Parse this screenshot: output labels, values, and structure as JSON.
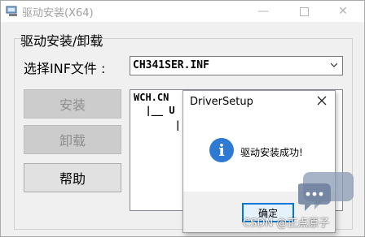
{
  "window": {
    "title": "驱动安装(X64)",
    "controls": {
      "minimize": "—",
      "close": "✕"
    }
  },
  "group": {
    "title": "驱动安装/卸载"
  },
  "inf": {
    "label": "选择INF文件 :",
    "selected": "CH341SER.INF"
  },
  "buttons": {
    "install": "安装",
    "uninstall": "卸载",
    "help": "帮助"
  },
  "tree": {
    "lines": [
      "WCH.CN",
      "  |__ U",
      "       |"
    ]
  },
  "dialog": {
    "title": "DriverSetup",
    "message": "驱动安装成功!",
    "ok": "确定",
    "icon": "i"
  },
  "watermark": "CSDN @正点原子",
  "colors": {
    "info_icon": "#2e79d2",
    "ok_border": "#0078d7",
    "disabled_button": "#cccccc"
  }
}
